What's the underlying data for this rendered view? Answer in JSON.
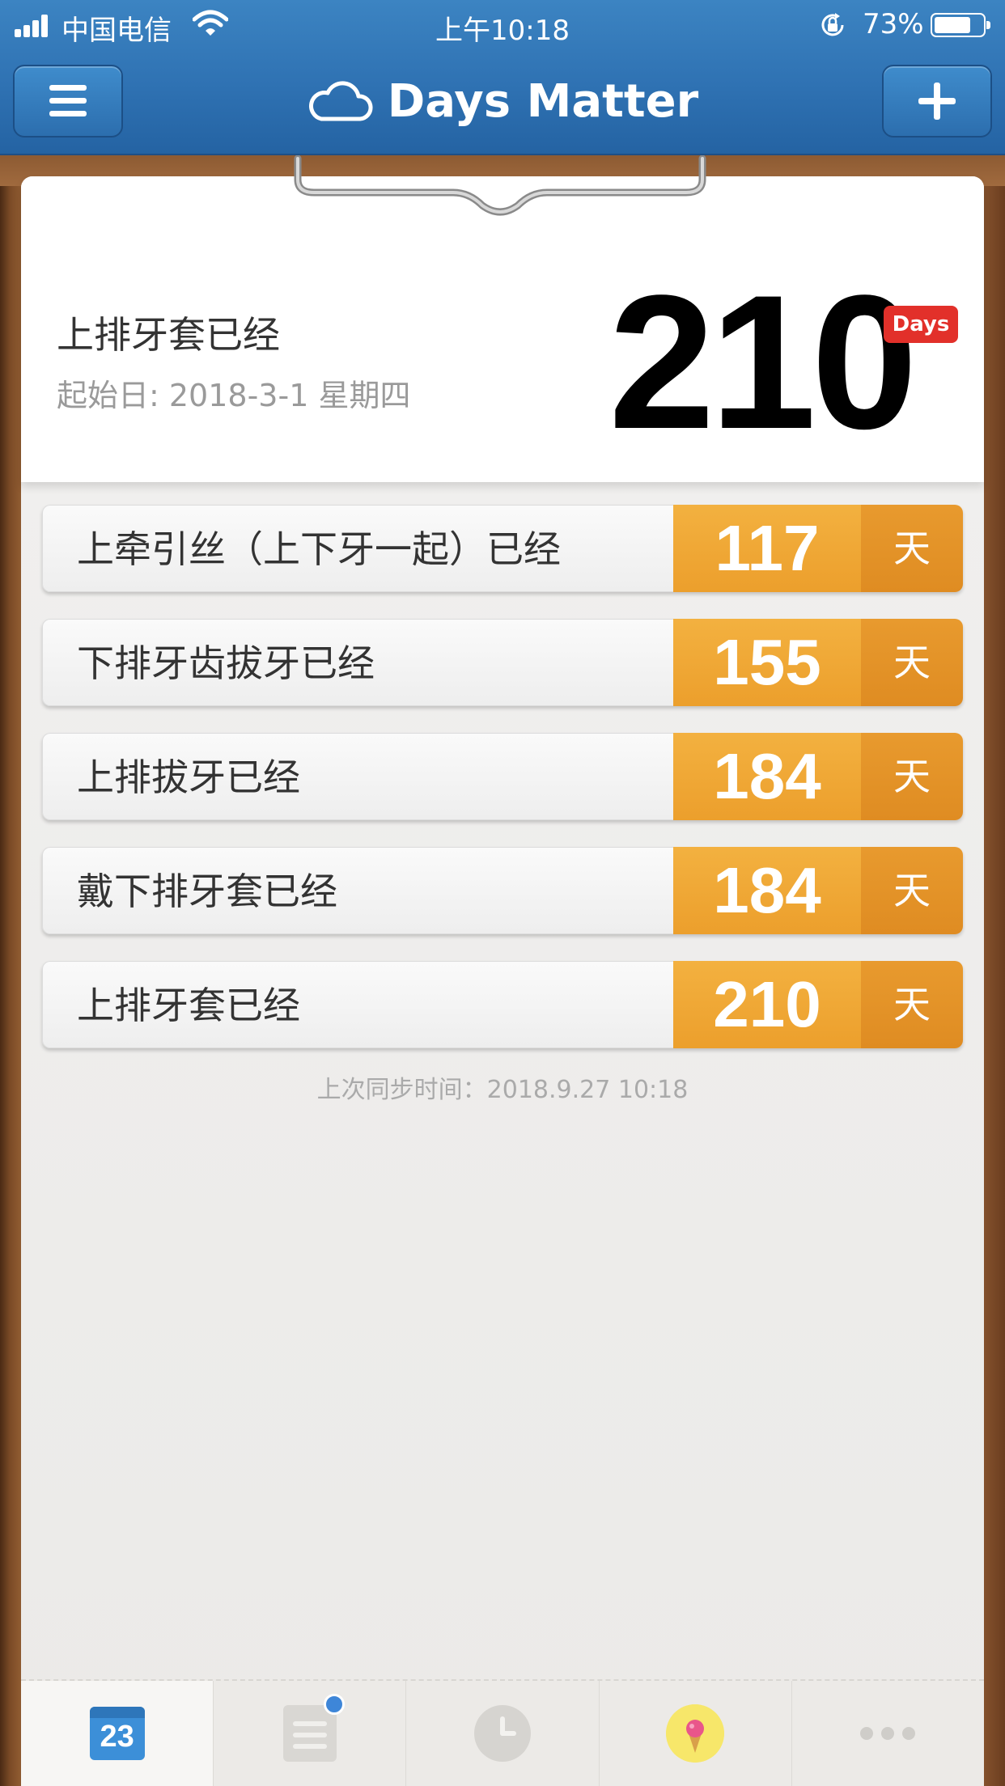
{
  "status_bar": {
    "carrier": "中国电信",
    "time": "上午10:18",
    "battery": "73%"
  },
  "header": {
    "title": "Days Matter"
  },
  "top_event": {
    "title": "上排牙套已经",
    "start_date": "起始日: 2018-3-1 星期四",
    "days": "210",
    "badge": "Days"
  },
  "events": [
    {
      "label": "上牵引丝（上下牙一起）已经",
      "days": "117",
      "unit": "天"
    },
    {
      "label": "下排牙齿拔牙已经",
      "days": "155",
      "unit": "天"
    },
    {
      "label": "上排拔牙已经",
      "days": "184",
      "unit": "天"
    },
    {
      "label": "戴下排牙套已经",
      "days": "184",
      "unit": "天"
    },
    {
      "label": "上排牙套已经",
      "days": "210",
      "unit": "天"
    }
  ],
  "sync_text": "上次同步时间：2018.9.27 10:18",
  "tabbar": {
    "calendar_day": "23"
  },
  "colors": {
    "header_blue": "#2f72b3",
    "badge_red": "#e2302a",
    "number_orange": "#ec9f2c"
  }
}
